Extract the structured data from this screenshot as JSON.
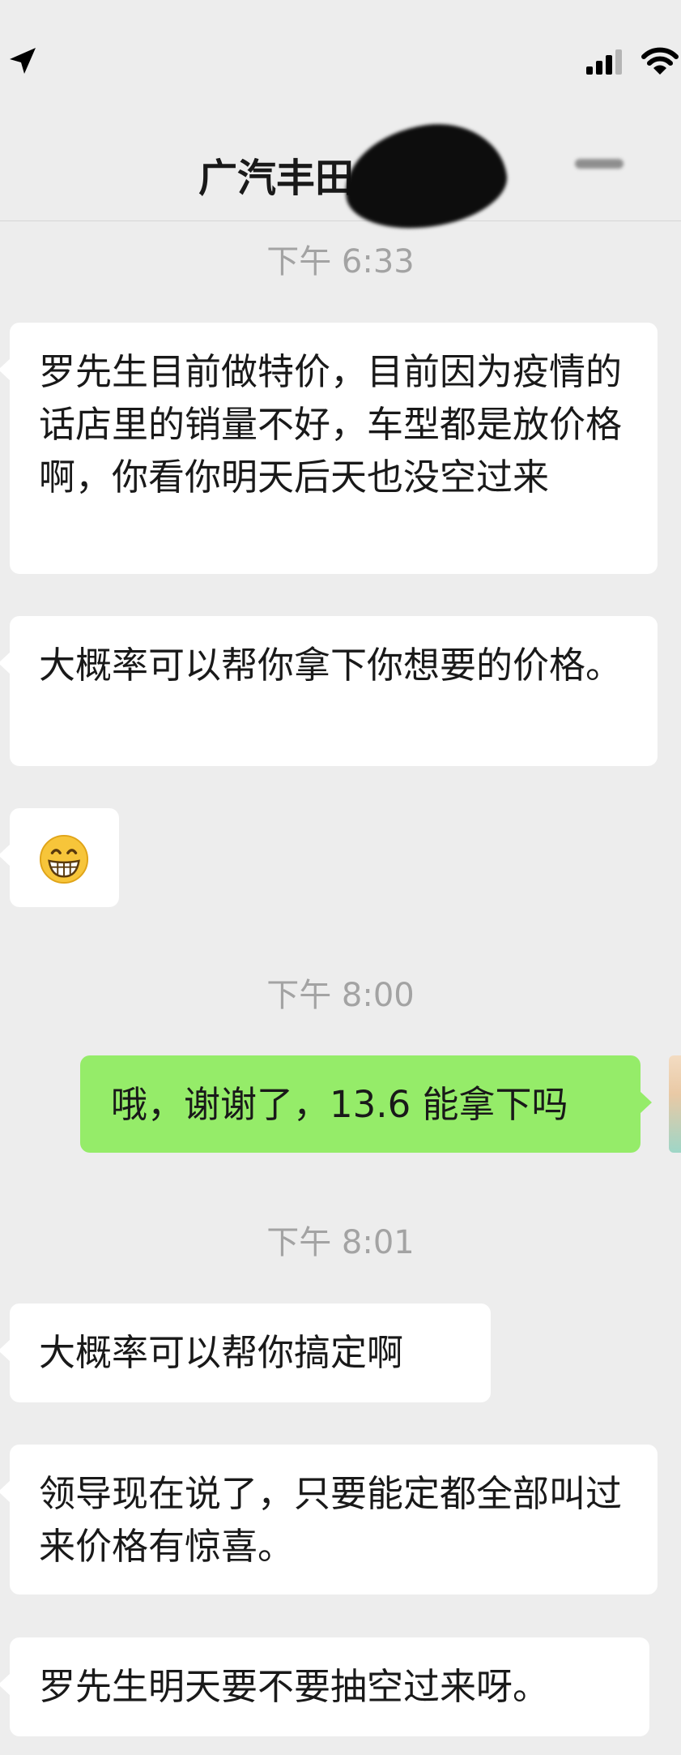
{
  "header": {
    "title": "广汽丰田"
  },
  "messages": [
    {
      "type": "time",
      "text": "下午 6:33"
    },
    {
      "type": "in",
      "text": "罗先生目前做特价，目前因为疫情的话店里的销量不好，车型都是放价格啊，你看你明天后天也没空过来"
    },
    {
      "type": "in",
      "text": "大概率可以帮你拿下你想要的价格。"
    },
    {
      "type": "in-emoji",
      "icon": "grinning-face-emoji"
    },
    {
      "type": "time",
      "text": "下午 8:00"
    },
    {
      "type": "out",
      "text": "哦，谢谢了，13.6 能拿下吗"
    },
    {
      "type": "time",
      "text": "下午 8:01"
    },
    {
      "type": "in",
      "text": "大概率可以帮你搞定啊"
    },
    {
      "type": "in",
      "text": "领导现在说了，只要能定都全部叫过来价格有惊喜。"
    },
    {
      "type": "in",
      "text": "罗先生明天要不要抽空过来呀。"
    }
  ],
  "colors": {
    "background": "#ededed",
    "incoming_bubble": "#ffffff",
    "outgoing_bubble": "#95ec69",
    "timestamp": "#a3a3a3"
  }
}
